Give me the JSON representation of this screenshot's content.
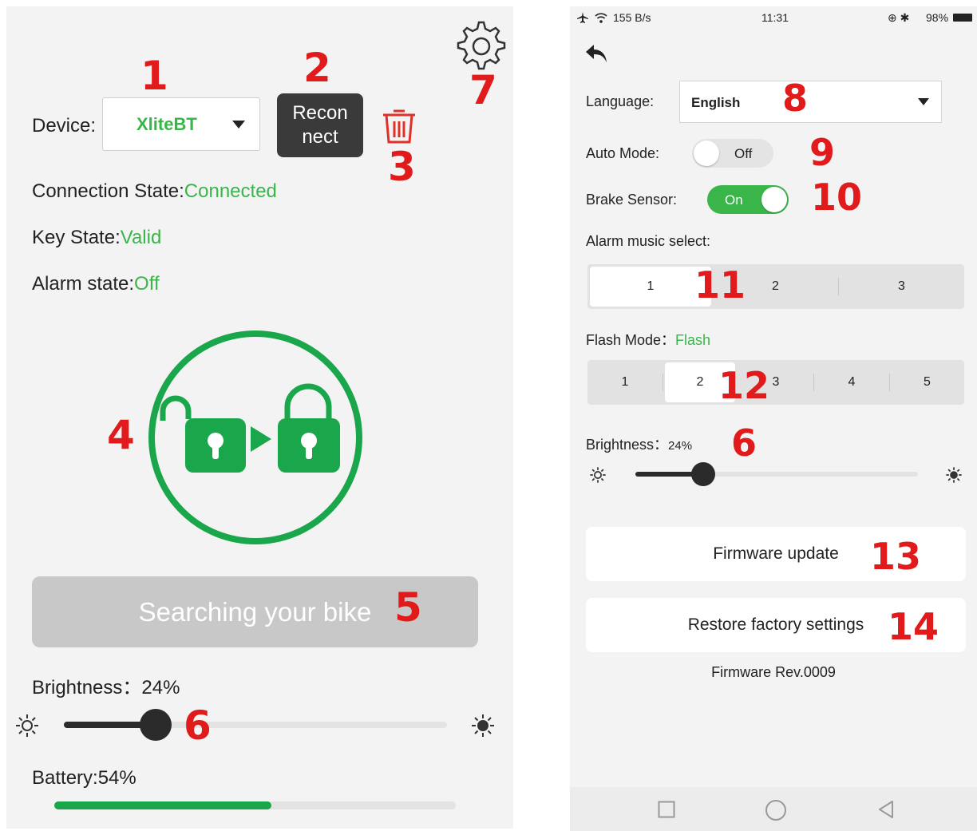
{
  "left": {
    "device_label": "Device:",
    "device_value": "XliteBT",
    "reconnect_line1": "Recon",
    "reconnect_line2": "nect",
    "connection_label": "Connection State:",
    "connection_value": "Connected",
    "key_label": "Key State:",
    "key_value": "Valid",
    "alarm_label": "Alarm state:",
    "alarm_value": "Off",
    "search_button": "Searching your bike",
    "brightness_label": "Brightness：",
    "brightness_value": "24%",
    "brightness_level": 0.24,
    "battery_label": "Battery:",
    "battery_value": "54%",
    "battery_level": 0.54
  },
  "right": {
    "status": {
      "net_speed": "155 B/s",
      "time": "11:31",
      "battery": "98%"
    },
    "language_label": "Language:",
    "language_value": "English",
    "auto_mode_label": "Auto Mode:",
    "auto_mode_value": "Off",
    "brake_sensor_label": "Brake Sensor:",
    "brake_sensor_value": "On",
    "alarm_music_label": "Alarm music select:",
    "alarm_music_options": [
      "1",
      "2",
      "3"
    ],
    "alarm_music_selected": "1",
    "flash_mode_label": "Flash Mode：",
    "flash_mode_value": "Flash",
    "flash_mode_options": [
      "1",
      "2",
      "3",
      "4",
      "5"
    ],
    "flash_mode_selected": "2",
    "brightness_label": "Brightness：",
    "brightness_value": "24%",
    "brightness_level": 0.24,
    "firmware_update": "Firmware update",
    "restore_factory": "Restore factory settings",
    "firmware_rev": "Firmware Rev.0009"
  },
  "annotations": [
    "1",
    "2",
    "3",
    "4",
    "5",
    "6",
    "7",
    "8",
    "9",
    "10",
    "11",
    "12",
    "6",
    "13",
    "14"
  ],
  "colors": {
    "accent_green": "#3ab54a",
    "annotation_red": "#e11b1b",
    "dark_button": "#3a3a3a"
  },
  "icons": [
    "gear-icon",
    "trash-icon",
    "lock-transition-icon",
    "sun-low-icon",
    "sun-high-icon",
    "back-arrow-icon",
    "airplane-icon",
    "wifi-icon",
    "square-nav-icon",
    "circle-nav-icon",
    "triangle-nav-icon"
  ]
}
